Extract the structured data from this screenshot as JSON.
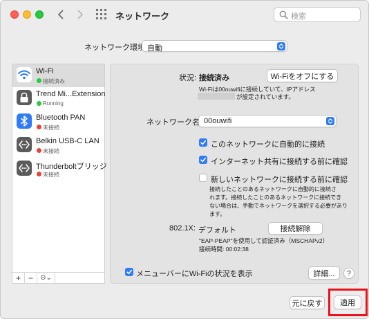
{
  "window": {
    "title": "ネットワーク",
    "search_placeholder": "検索"
  },
  "location": {
    "label": "ネットワーク環境:",
    "value": "自動"
  },
  "services": [
    {
      "name": "Wi-Fi",
      "status": "接続済み",
      "status_color": "#29c941",
      "icon": "wifi-icon",
      "selected": true
    },
    {
      "name": "Trend Mi...Extension",
      "status": "Running",
      "status_color": "#29c941",
      "icon": "padlock-icon",
      "selected": false
    },
    {
      "name": "Bluetooth PAN",
      "status": "未接続",
      "status_color": "#e5453c",
      "icon": "bluetooth-icon",
      "selected": false
    },
    {
      "name": "Belkin USB-C LAN",
      "status": "未接続",
      "status_color": "#e5453c",
      "icon": "ethernet-icon",
      "selected": false
    },
    {
      "name": "Thunderboltブリッジ",
      "status": "未接続",
      "status_color": "#e5453c",
      "icon": "ethernet-icon",
      "selected": false
    }
  ],
  "sidebar_toolbar": {
    "add": "+",
    "remove": "−",
    "action": "⊝⌄"
  },
  "detail": {
    "status_label": "状況:",
    "status_value": "接続済み",
    "wifi_off_button": "Wi-Fiをオフにする",
    "status_desc_line1": "Wi-Fiは00ouwifiに接続していて、IPアドレス",
    "status_desc_line2": "が設定されています。",
    "network_name_label": "ネットワーク名:",
    "network_name_value": "00ouwifi",
    "options": [
      {
        "label": "このネットワークに自動的に接続",
        "checked": true
      },
      {
        "label": "インターネット共有に接続する前に確認",
        "checked": true
      },
      {
        "label": "新しいネットワークに接続する前に確認",
        "checked": false
      }
    ],
    "new_network_desc": [
      "接続したことのあるネットワークに自動的に接続さ",
      "れます。接続したことのあるネットワークに接続でき",
      "ない場合は、手動でネットワークを選択する必要があり",
      "ます。"
    ],
    "dot1x_label": "802.1X:",
    "dot1x_value": "デフォルト",
    "disconnect_button": "接続解除",
    "dot1x_detail1": "\"EAP-PEAP\"を使用して認証済み（MSCHAPv2）",
    "dot1x_detail2": "接続時間: 00:02:38",
    "menubar_label": "メニューバーにWi-Fiの状況を表示",
    "menubar_checked": true,
    "advanced_button": "詳細...",
    "help_button": "?"
  },
  "footer": {
    "revert_button": "元に戻す",
    "apply_button": "適用"
  },
  "colors": {
    "accent": "#2f7cf6",
    "highlight": "#e8121d"
  }
}
